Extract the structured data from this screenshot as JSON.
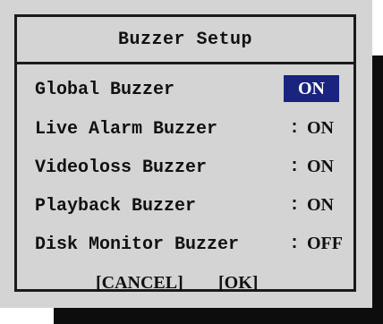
{
  "dialog": {
    "title": "Buzzer Setup",
    "items": [
      {
        "label": "Global Buzzer",
        "separator": "",
        "value": "ON",
        "selected": true
      },
      {
        "label": "Live Alarm Buzzer",
        "separator": ":",
        "value": "ON",
        "selected": false
      },
      {
        "label": "Videoloss Buzzer",
        "separator": ":",
        "value": "ON",
        "selected": false
      },
      {
        "label": "Playback Buzzer",
        "separator": ":",
        "value": "ON",
        "selected": false
      },
      {
        "label": "Disk Monitor Buzzer",
        "separator": ":",
        "value": "OFF",
        "selected": false
      }
    ],
    "cancel_label": "[CANCEL]",
    "ok_label": "[OK]"
  },
  "colors": {
    "dialog_bg": "#d4d4d4",
    "selection_bg": "#1a237e",
    "selection_fg": "#ffffff",
    "text": "#111111",
    "shadow": "#0d0d0d"
  }
}
